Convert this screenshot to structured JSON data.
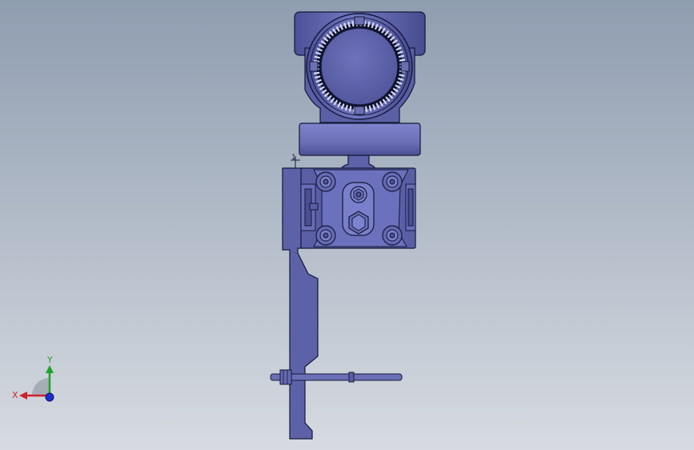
{
  "viewport": {
    "background_top": "#8f9db0",
    "background_bottom": "#d7dbe1"
  },
  "model": {
    "body_color": "#6a6fb3",
    "shade_color": "#4d5296",
    "highlight_color": "#8a8fd0",
    "edge_color": "#141838",
    "annotation": "1"
  },
  "triad": {
    "x_label": "X",
    "y_label": "Y",
    "x_color": "#d0202a",
    "y_color": "#1fa32a",
    "z_color": "#1b2fd0"
  }
}
